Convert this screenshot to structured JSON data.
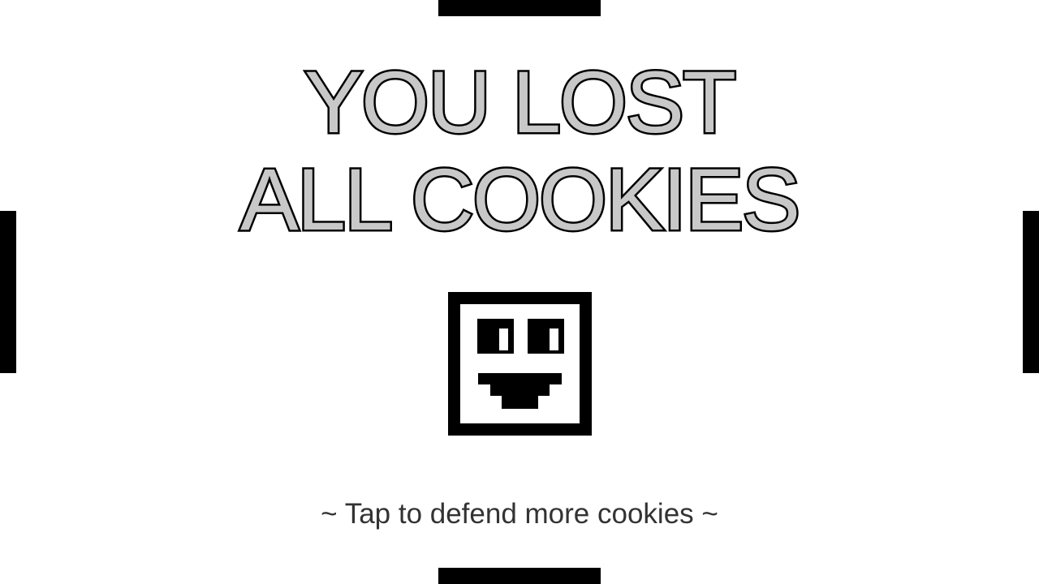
{
  "game_over": {
    "title_line_1": "YOU LOST",
    "title_line_2": "ALL COOKIES",
    "prompt": "~ Tap to defend more cookies ~",
    "face_icon": "pixel-smiley-face-icon"
  },
  "colors": {
    "background": "#ffffff",
    "title_fill": "#c8c8c8",
    "outline": "#000000",
    "prompt_text": "#333333"
  }
}
